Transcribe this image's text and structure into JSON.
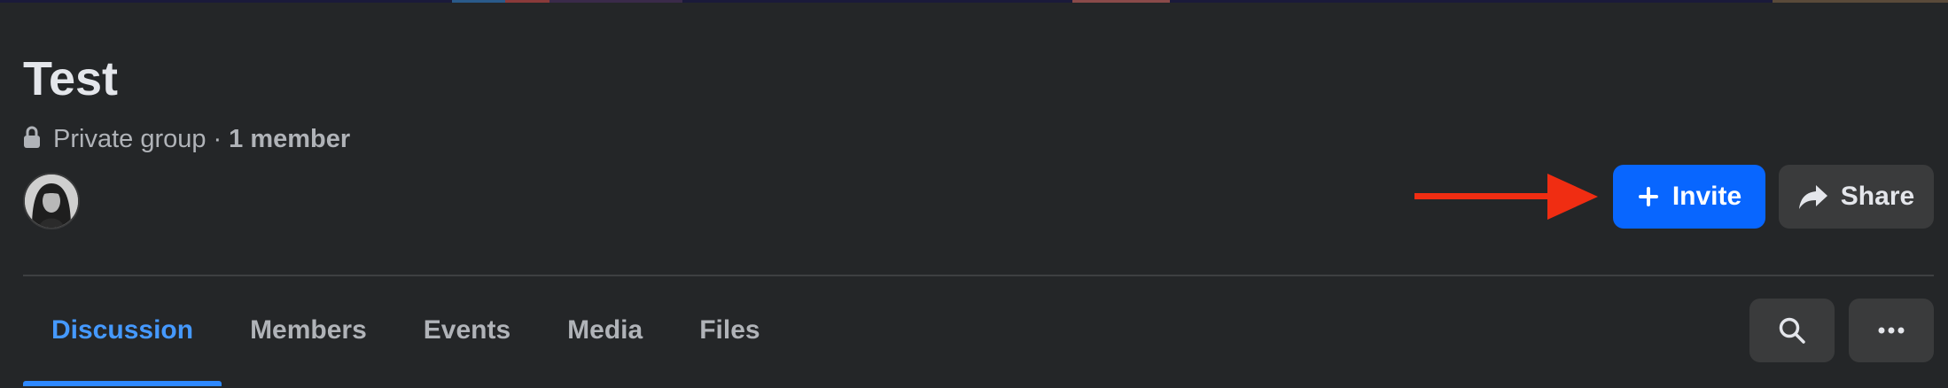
{
  "group": {
    "title": "Test",
    "privacy_label": "Private group",
    "separator": "·",
    "member_count": "1 member"
  },
  "actions": {
    "invite_label": "Invite",
    "share_label": "Share"
  },
  "tabs": [
    {
      "label": "Discussion",
      "active": true
    },
    {
      "label": "Members",
      "active": false
    },
    {
      "label": "Events",
      "active": false
    },
    {
      "label": "Media",
      "active": false
    },
    {
      "label": "Files",
      "active": false
    }
  ],
  "icons": {
    "lock": "lock-icon",
    "plus": "plus-icon",
    "share": "share-arrow-icon",
    "search": "search-icon",
    "more": "more-horizontal-icon"
  },
  "colors": {
    "background": "#242628",
    "primary_button": "#0866ff",
    "active_tab": "#4599ff",
    "annotation_arrow": "#f02d12"
  }
}
